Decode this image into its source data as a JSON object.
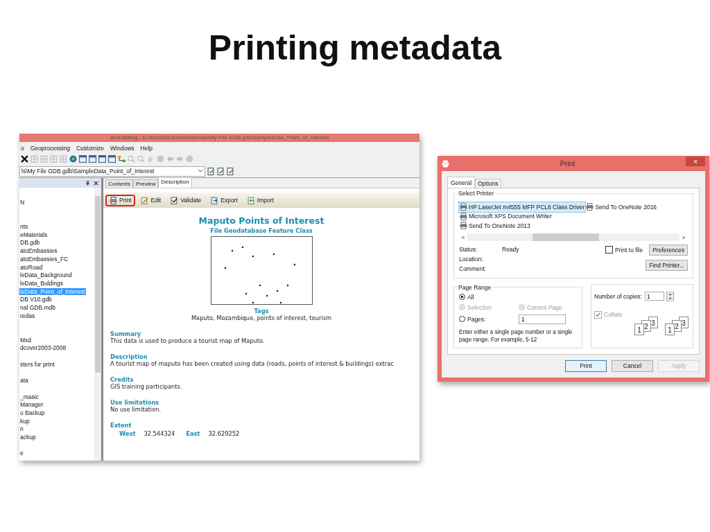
{
  "slide_title": "Printing metadata",
  "catalog": {
    "title": "ArcCatalog - D:\\ArcGISCourseMaterials\\My File GDB.gdb\\SampleData_Point_of_Interest",
    "menu": [
      "o",
      "Geoprocessing",
      "Customize",
      "Windows",
      "Help"
    ],
    "address": "ls\\My File GDB.gdb\\SampleData_Point_of_Interest",
    "tree": [
      {
        "kind": "item",
        "label": "N",
        "selected": false
      },
      {
        "kind": "spacer"
      },
      {
        "kind": "spacer"
      },
      {
        "kind": "item",
        "label": "nts",
        "selected": false
      },
      {
        "kind": "item",
        "label": "eMaterials",
        "selected": false
      },
      {
        "kind": "item",
        "label": "DB.gdb",
        "selected": false
      },
      {
        "kind": "item",
        "label": "atoEmbassies",
        "selected": false
      },
      {
        "kind": "item",
        "label": "atoEmbassies_FC",
        "selected": false
      },
      {
        "kind": "item",
        "label": "atoRoad",
        "selected": false
      },
      {
        "kind": "item",
        "label": "leData_Background",
        "selected": false
      },
      {
        "kind": "item",
        "label": "leData_Buldings",
        "selected": false
      },
      {
        "kind": "item",
        "label": "leData_Point_of_Interest",
        "selected": true
      },
      {
        "kind": "item",
        "label": "DB V10.gdb",
        "selected": false
      },
      {
        "kind": "item",
        "label": "nal GDB.mdb",
        "selected": false
      },
      {
        "kind": "item",
        "label": "redas",
        "selected": false
      },
      {
        "kind": "spacer"
      },
      {
        "kind": "spacer"
      },
      {
        "kind": "item",
        "label": "Mxd",
        "selected": false
      },
      {
        "kind": "item",
        "label": "dcover2003-2008",
        "selected": false
      },
      {
        "kind": "spacer"
      },
      {
        "kind": "item",
        "label": "sters for print",
        "selected": false
      },
      {
        "kind": "spacer"
      },
      {
        "kind": "item",
        "label": "ata",
        "selected": false
      },
      {
        "kind": "spacer"
      },
      {
        "kind": "item",
        "label": "_masic",
        "selected": false
      },
      {
        "kind": "item",
        "label": "Manager",
        "selected": false
      },
      {
        "kind": "item",
        "label": "o Backup",
        "selected": false
      },
      {
        "kind": "item",
        "label": "kup",
        "selected": false
      },
      {
        "kind": "item",
        "label": "n",
        "selected": false
      },
      {
        "kind": "item",
        "label": "ackup",
        "selected": false
      },
      {
        "kind": "spacer"
      },
      {
        "kind": "item",
        "label": "e",
        "selected": false
      }
    ],
    "tabs": [
      {
        "label": "Contents",
        "selected": false
      },
      {
        "label": "Preview",
        "selected": false
      },
      {
        "label": "Description",
        "selected": true
      }
    ],
    "toolbar": [
      {
        "kind": "print",
        "label": "Print",
        "highlighted": true
      },
      {
        "kind": "edit",
        "label": "Edit",
        "highlighted": false
      },
      {
        "kind": "validate",
        "label": "Validate",
        "highlighted": false
      },
      {
        "kind": "export",
        "label": "Export",
        "highlighted": false
      },
      {
        "kind": "import",
        "label": "Import",
        "highlighted": false
      }
    ],
    "doc": {
      "title": "Maputo Points of Interest",
      "subtitle": "File Geodatabase Feature Class",
      "tags_heading": "Tags",
      "tags": "Maputo, Mozambique, points of interest, tourism",
      "sections": [
        {
          "heading": "Summary",
          "text": "This data is used to produce a tourist map of Maputo."
        },
        {
          "heading": "Description",
          "text": "A tourist map of maputo has been created using data (roads, points of interest & buildings) extrac"
        },
        {
          "heading": "Credits",
          "text": "GIS training participants."
        },
        {
          "heading": "Use limitations",
          "text": "No use limitation."
        }
      ],
      "extent_heading": "Extent",
      "extent": [
        {
          "label": "West",
          "value": "32.544324"
        },
        {
          "label": "East",
          "value": "32.629252"
        }
      ]
    }
  },
  "print_dialog": {
    "title": "Print",
    "close": "×",
    "tabs": [
      {
        "label": "General",
        "selected": true
      },
      {
        "label": "Options",
        "selected": false
      }
    ],
    "select_printer_label": "Select Printer",
    "printers": [
      {
        "name": "HP LaserJet m4555 MFP PCL6 Class Driver",
        "selected": true
      },
      {
        "name": "Microsoft XPS Document Writer",
        "selected": false
      },
      {
        "name": "Send To OneNote 2013",
        "selected": false
      },
      {
        "name": "Send To OneNote 2016",
        "selected": false
      }
    ],
    "scroll_left": "<",
    "scroll_right": ">",
    "info": [
      {
        "label": "Status:",
        "value": "Ready"
      },
      {
        "label": "Location:"
      },
      {
        "label": "Comment:"
      }
    ],
    "print_to_file": {
      "label": "Print to file",
      "checked": false
    },
    "preferences": "Preferences",
    "find_printer": "Find Printer...",
    "page_range_label": "Page Range",
    "ranges": [
      {
        "label": "All",
        "selected": true,
        "disabled": false
      },
      {
        "label": "Selection",
        "selected": false,
        "disabled": true
      },
      {
        "label": "Current Page",
        "selected": false,
        "disabled": true
      },
      {
        "label": "Pages:",
        "selected": false,
        "disabled": false
      }
    ],
    "pages_value": "1",
    "hint": "Enter either a single page number or a single page range.  For example, 5-12",
    "copies_label": "Number of copies:",
    "copies_value": "1",
    "collate": {
      "label": "Collate",
      "checked": true,
      "disabled": true
    },
    "collate_stacks": [
      [
        "1",
        "2",
        "3"
      ],
      [
        "1",
        "2",
        "3"
      ]
    ],
    "buttons": [
      {
        "label": "Print",
        "disabled": false,
        "default": true
      },
      {
        "label": "Cancel",
        "disabled": false,
        "default": false
      },
      {
        "label": "Apply",
        "disabled": true,
        "default": false
      }
    ]
  }
}
